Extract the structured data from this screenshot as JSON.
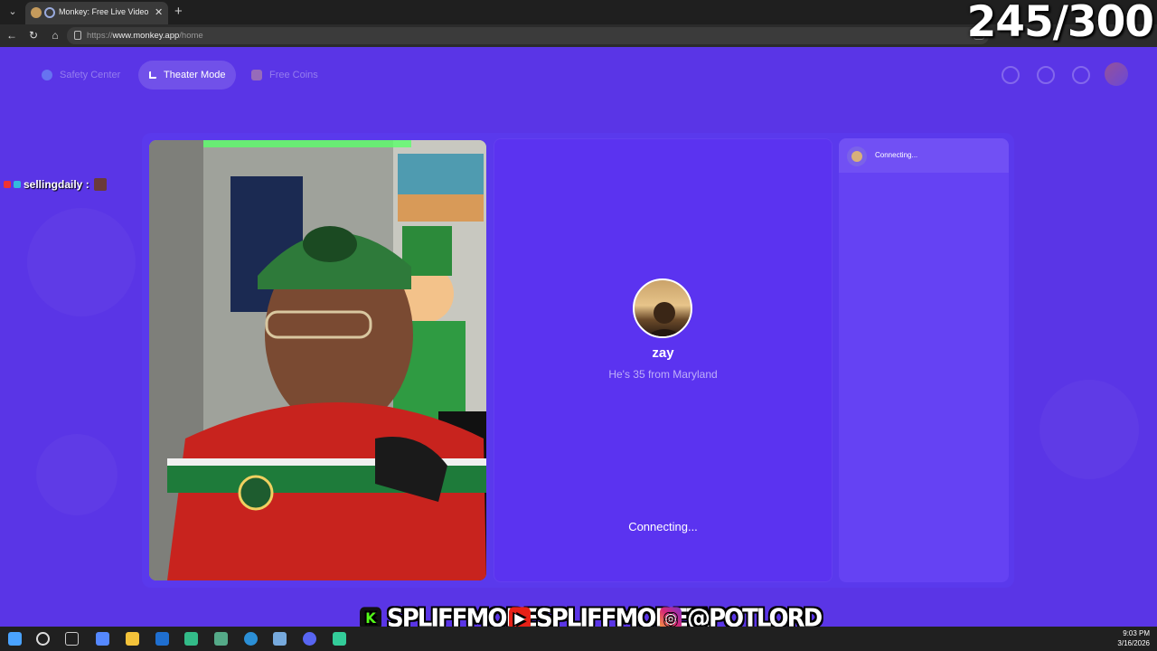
{
  "browser": {
    "tab_title": "Monkey: Free Live Video Chat",
    "url_prefix": "https://",
    "url_host": "www.monkey.app",
    "url_path": "/home"
  },
  "stream": {
    "counter": "245/300",
    "chat_user": "sellingdaily :",
    "socials": [
      "SPLIFFMODE",
      "SPLIFFMODETV",
      "@POTLORD"
    ]
  },
  "app": {
    "header": {
      "safety_label": "Safety Center",
      "theater_label": "Theater Mode",
      "coins_label": "Free Coins"
    },
    "peer": {
      "name": "zay",
      "info": "He's 35 from Maryland",
      "status": "Connecting..."
    },
    "chat": {
      "status": "Connecting..."
    }
  },
  "taskbar": {
    "time": "9:03 PM",
    "date": "3/16/2026"
  },
  "colors": {
    "app_bg": "#5a35e6",
    "panel": "#5b33f0"
  }
}
